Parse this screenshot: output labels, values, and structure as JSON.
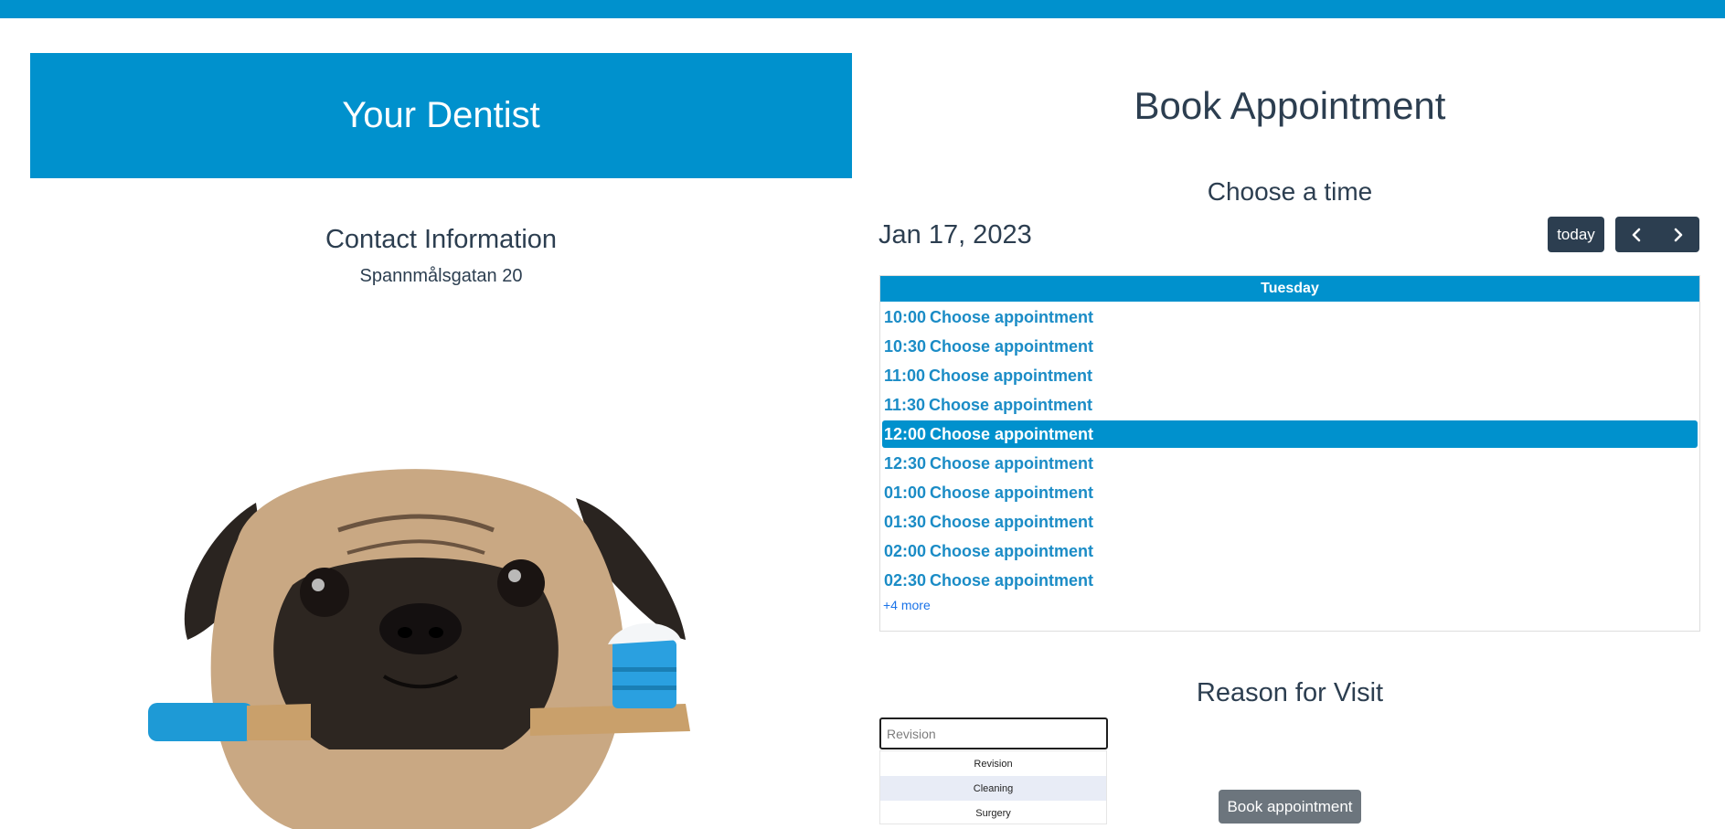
{
  "brand": {
    "title": "Your Dentist",
    "banner_color": "#0091cd"
  },
  "contact": {
    "title": "Contact Information",
    "address": "Spannmålsgatan 20"
  },
  "booking": {
    "title": "Book Appointment",
    "subtitle": "Choose a time"
  },
  "calendar": {
    "date": "Jan 17, 2023",
    "today_label": "today",
    "prev_icon": "chevron-left-icon",
    "next_icon": "chevron-right-icon",
    "day_header": "Tuesday",
    "slots": [
      {
        "time": "10:00",
        "label": "Choose appointment"
      },
      {
        "time": "10:30",
        "label": "Choose appointment"
      },
      {
        "time": "11:00",
        "label": "Choose appointment"
      },
      {
        "time": "11:30",
        "label": "Choose appointment"
      },
      {
        "time": "12:00",
        "label": "Choose appointment",
        "selected": true
      },
      {
        "time": "12:30",
        "label": "Choose appointment"
      },
      {
        "time": "01:00",
        "label": "Choose appointment"
      },
      {
        "time": "01:30",
        "label": "Choose appointment"
      },
      {
        "time": "02:00",
        "label": "Choose appointment"
      },
      {
        "time": "02:30",
        "label": "Choose appointment"
      }
    ],
    "more_link": "+4 more",
    "accent_color": "#0091cd"
  },
  "reason": {
    "title": "Reason for Visit",
    "placeholder": "Revision",
    "options": [
      "Revision",
      "Cleaning",
      "Surgery"
    ],
    "highlighted_option": "Cleaning"
  },
  "submit": {
    "label": "Book appointment"
  }
}
